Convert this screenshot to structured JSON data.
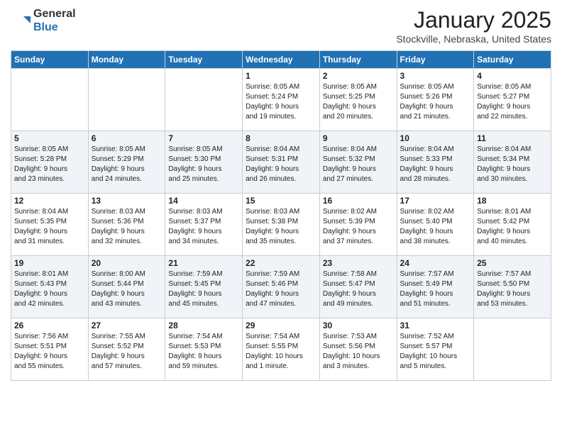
{
  "header": {
    "logo_general": "General",
    "logo_blue": "Blue",
    "month": "January 2025",
    "location": "Stockville, Nebraska, United States"
  },
  "days_of_week": [
    "Sunday",
    "Monday",
    "Tuesday",
    "Wednesday",
    "Thursday",
    "Friday",
    "Saturday"
  ],
  "weeks": [
    [
      {
        "day": "",
        "info": ""
      },
      {
        "day": "",
        "info": ""
      },
      {
        "day": "",
        "info": ""
      },
      {
        "day": "1",
        "info": "Sunrise: 8:05 AM\nSunset: 5:24 PM\nDaylight: 9 hours\nand 19 minutes."
      },
      {
        "day": "2",
        "info": "Sunrise: 8:05 AM\nSunset: 5:25 PM\nDaylight: 9 hours\nand 20 minutes."
      },
      {
        "day": "3",
        "info": "Sunrise: 8:05 AM\nSunset: 5:26 PM\nDaylight: 9 hours\nand 21 minutes."
      },
      {
        "day": "4",
        "info": "Sunrise: 8:05 AM\nSunset: 5:27 PM\nDaylight: 9 hours\nand 22 minutes."
      }
    ],
    [
      {
        "day": "5",
        "info": "Sunrise: 8:05 AM\nSunset: 5:28 PM\nDaylight: 9 hours\nand 23 minutes."
      },
      {
        "day": "6",
        "info": "Sunrise: 8:05 AM\nSunset: 5:29 PM\nDaylight: 9 hours\nand 24 minutes."
      },
      {
        "day": "7",
        "info": "Sunrise: 8:05 AM\nSunset: 5:30 PM\nDaylight: 9 hours\nand 25 minutes."
      },
      {
        "day": "8",
        "info": "Sunrise: 8:04 AM\nSunset: 5:31 PM\nDaylight: 9 hours\nand 26 minutes."
      },
      {
        "day": "9",
        "info": "Sunrise: 8:04 AM\nSunset: 5:32 PM\nDaylight: 9 hours\nand 27 minutes."
      },
      {
        "day": "10",
        "info": "Sunrise: 8:04 AM\nSunset: 5:33 PM\nDaylight: 9 hours\nand 28 minutes."
      },
      {
        "day": "11",
        "info": "Sunrise: 8:04 AM\nSunset: 5:34 PM\nDaylight: 9 hours\nand 30 minutes."
      }
    ],
    [
      {
        "day": "12",
        "info": "Sunrise: 8:04 AM\nSunset: 5:35 PM\nDaylight: 9 hours\nand 31 minutes."
      },
      {
        "day": "13",
        "info": "Sunrise: 8:03 AM\nSunset: 5:36 PM\nDaylight: 9 hours\nand 32 minutes."
      },
      {
        "day": "14",
        "info": "Sunrise: 8:03 AM\nSunset: 5:37 PM\nDaylight: 9 hours\nand 34 minutes."
      },
      {
        "day": "15",
        "info": "Sunrise: 8:03 AM\nSunset: 5:38 PM\nDaylight: 9 hours\nand 35 minutes."
      },
      {
        "day": "16",
        "info": "Sunrise: 8:02 AM\nSunset: 5:39 PM\nDaylight: 9 hours\nand 37 minutes."
      },
      {
        "day": "17",
        "info": "Sunrise: 8:02 AM\nSunset: 5:40 PM\nDaylight: 9 hours\nand 38 minutes."
      },
      {
        "day": "18",
        "info": "Sunrise: 8:01 AM\nSunset: 5:42 PM\nDaylight: 9 hours\nand 40 minutes."
      }
    ],
    [
      {
        "day": "19",
        "info": "Sunrise: 8:01 AM\nSunset: 5:43 PM\nDaylight: 9 hours\nand 42 minutes."
      },
      {
        "day": "20",
        "info": "Sunrise: 8:00 AM\nSunset: 5:44 PM\nDaylight: 9 hours\nand 43 minutes."
      },
      {
        "day": "21",
        "info": "Sunrise: 7:59 AM\nSunset: 5:45 PM\nDaylight: 9 hours\nand 45 minutes."
      },
      {
        "day": "22",
        "info": "Sunrise: 7:59 AM\nSunset: 5:46 PM\nDaylight: 9 hours\nand 47 minutes."
      },
      {
        "day": "23",
        "info": "Sunrise: 7:58 AM\nSunset: 5:47 PM\nDaylight: 9 hours\nand 49 minutes."
      },
      {
        "day": "24",
        "info": "Sunrise: 7:57 AM\nSunset: 5:49 PM\nDaylight: 9 hours\nand 51 minutes."
      },
      {
        "day": "25",
        "info": "Sunrise: 7:57 AM\nSunset: 5:50 PM\nDaylight: 9 hours\nand 53 minutes."
      }
    ],
    [
      {
        "day": "26",
        "info": "Sunrise: 7:56 AM\nSunset: 5:51 PM\nDaylight: 9 hours\nand 55 minutes."
      },
      {
        "day": "27",
        "info": "Sunrise: 7:55 AM\nSunset: 5:52 PM\nDaylight: 9 hours\nand 57 minutes."
      },
      {
        "day": "28",
        "info": "Sunrise: 7:54 AM\nSunset: 5:53 PM\nDaylight: 9 hours\nand 59 minutes."
      },
      {
        "day": "29",
        "info": "Sunrise: 7:54 AM\nSunset: 5:55 PM\nDaylight: 10 hours\nand 1 minute."
      },
      {
        "day": "30",
        "info": "Sunrise: 7:53 AM\nSunset: 5:56 PM\nDaylight: 10 hours\nand 3 minutes."
      },
      {
        "day": "31",
        "info": "Sunrise: 7:52 AM\nSunset: 5:57 PM\nDaylight: 10 hours\nand 5 minutes."
      },
      {
        "day": "",
        "info": ""
      }
    ]
  ]
}
